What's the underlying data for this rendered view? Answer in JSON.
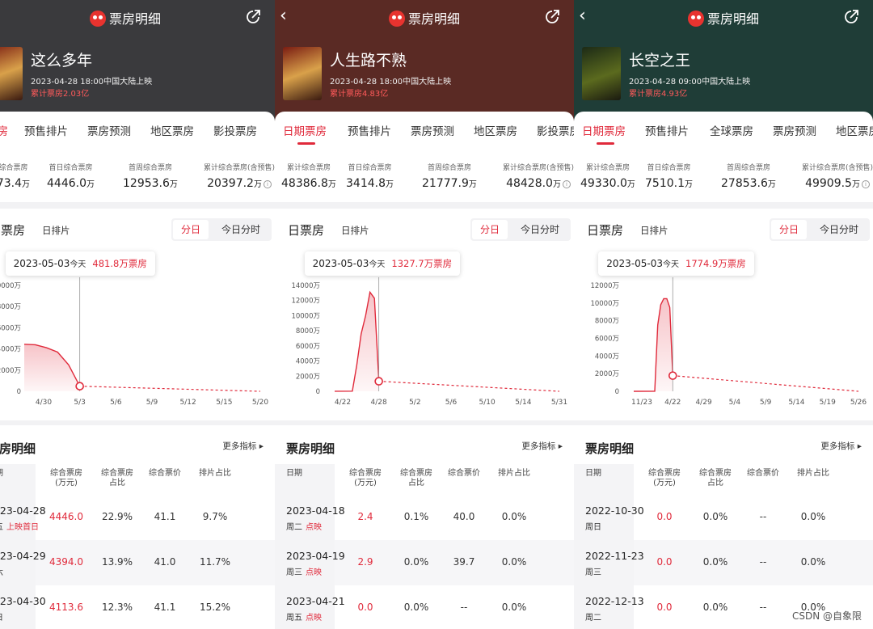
{
  "brand": "票房明细",
  "stat_labels": [
    "累计综合票房",
    "首日综合票房",
    "首周综合票房",
    "累计综合票房(含预售)"
  ],
  "unit_wan": "万",
  "chart_toggle": [
    "分日",
    "今日分时"
  ],
  "chart_title": "日票房",
  "chart_subtitle": "日排片",
  "table_title": "票房明细",
  "more_metrics": "更多指标 ▸",
  "table_headers": [
    "日期",
    "综合票房\n(万元)",
    "综合票房\n占比",
    "综合票价",
    "排片占比"
  ],
  "watermark": "CSDN @自象限",
  "accent": "#e02a3b",
  "panels": [
    {
      "hero_color": "#3a3a3d",
      "show_back": false,
      "title": "这么多年",
      "release": "2023-04-28 18:00中国大陆上映",
      "cumulative": "累计票房2.03亿",
      "tabs": [
        "日期票房",
        "预售排片",
        "票房预测",
        "地区票房",
        "影投票房"
      ],
      "stats": [
        "7373.4",
        "4446.0",
        "12953.6",
        "20397.2"
      ],
      "tooltip": {
        "date": "2023-05-03",
        "today": "今天",
        "value": "481.8万票房"
      },
      "chart_data": {
        "type": "area",
        "y_ticks": [
          "0",
          "2000万",
          "4000万",
          "6000万",
          "8000万",
          "10000万"
        ],
        "ylim": [
          0,
          10000
        ],
        "x_ticks": [
          "4/30",
          "5/3",
          "5/6",
          "5/9",
          "5/12",
          "5/15",
          "5/20"
        ],
        "points": [
          [
            -1,
            4446
          ],
          [
            0,
            4394
          ],
          [
            1,
            4113.6
          ],
          [
            2,
            3700
          ],
          [
            3,
            2500
          ],
          [
            4,
            481.8
          ]
        ],
        "current_index": 4
      },
      "rows": [
        {
          "date": "2023-04-28",
          "weekday": "周五",
          "tag": "上映首日",
          "box": "4446.0",
          "share": "22.9%",
          "price": "41.1",
          "screen": "9.7%"
        },
        {
          "date": "2023-04-29",
          "weekday": "周六",
          "tag": "",
          "box": "4394.0",
          "share": "13.9%",
          "price": "41.0",
          "screen": "11.7%"
        },
        {
          "date": "2023-04-30",
          "weekday": "周日",
          "tag": "",
          "box": "4113.6",
          "share": "12.3%",
          "price": "41.1",
          "screen": "15.2%"
        }
      ]
    },
    {
      "hero_color": "#5a2a24",
      "show_back": true,
      "title": "人生路不熟",
      "release": "2023-04-28 18:00中国大陆上映",
      "cumulative": "累计票房4.83亿",
      "tabs": [
        "日期票房",
        "预售排片",
        "票房预测",
        "地区票房",
        "影投票房"
      ],
      "stats": [
        "48386.8",
        "3414.8",
        "21777.9",
        "48428.0"
      ],
      "tooltip": {
        "date": "2023-05-03",
        "today": "今天",
        "value": "1327.7万票房"
      },
      "chart_data": {
        "type": "area",
        "y_ticks": [
          "0",
          "2000万",
          "4000万",
          "6000万",
          "8000万",
          "10000万",
          "12000万",
          "14000万"
        ],
        "ylim": [
          0,
          14000
        ],
        "x_ticks": [
          "4/22",
          "4/28",
          "5/2",
          "5/6",
          "5/10",
          "5/14",
          "5/31"
        ],
        "points": [
          [
            0,
            10
          ],
          [
            4,
            20
          ],
          [
            5,
            3414.8
          ],
          [
            6,
            7600
          ],
          [
            7,
            10000
          ],
          [
            8,
            13100
          ],
          [
            9,
            12300
          ],
          [
            10,
            1327.7
          ]
        ],
        "current_index": 7
      },
      "rows": [
        {
          "date": "2023-04-18",
          "weekday": "周二",
          "tag": "点映",
          "box": "2.4",
          "share": "0.1%",
          "price": "40.0",
          "screen": "0.0%"
        },
        {
          "date": "2023-04-19",
          "weekday": "周三",
          "tag": "点映",
          "box": "2.9",
          "share": "0.0%",
          "price": "39.7",
          "screen": "0.0%"
        },
        {
          "date": "2023-04-21",
          "weekday": "周五",
          "tag": "点映",
          "box": "0.0",
          "share": "0.0%",
          "price": "--",
          "screen": "0.0%"
        }
      ]
    },
    {
      "hero_color": "#1f3d37",
      "show_back": true,
      "title": "长空之王",
      "release": "2023-04-28 09:00中国大陆上映",
      "cumulative": "累计票房4.93亿",
      "tabs": [
        "日期票房",
        "预售排片",
        "全球票房",
        "票房预测",
        "地区票房"
      ],
      "stats": [
        "49330.0",
        "7510.1",
        "27853.6",
        "49909.5"
      ],
      "tooltip": {
        "date": "2023-05-03",
        "today": "今天",
        "value": "1774.9万票房"
      },
      "chart_data": {
        "type": "area",
        "y_ticks": [
          "0",
          "2000万",
          "4000万",
          "6000万",
          "8000万",
          "10000万",
          "12000万"
        ],
        "ylim": [
          0,
          12000
        ],
        "x_ticks": [
          "11/23",
          "4/22",
          "4/29",
          "5/4",
          "5/9",
          "5/14",
          "5/19",
          "5/26"
        ],
        "points": [
          [
            0,
            0
          ],
          [
            7,
            10
          ],
          [
            8,
            7510.1
          ],
          [
            9,
            9800
          ],
          [
            10,
            10500
          ],
          [
            11,
            10500
          ],
          [
            12,
            9500
          ],
          [
            13,
            1774.9
          ]
        ],
        "current_index": 7
      },
      "rows": [
        {
          "date": "2022-10-30",
          "weekday": "周日",
          "tag": "",
          "box": "0.0",
          "share": "0.0%",
          "price": "--",
          "screen": "0.0%"
        },
        {
          "date": "2022-11-23",
          "weekday": "周三",
          "tag": "",
          "box": "0.0",
          "share": "0.0%",
          "price": "--",
          "screen": "0.0%"
        },
        {
          "date": "2022-12-13",
          "weekday": "周二",
          "tag": "",
          "box": "0.0",
          "share": "0.0%",
          "price": "--",
          "screen": "0.0%"
        }
      ]
    }
  ]
}
